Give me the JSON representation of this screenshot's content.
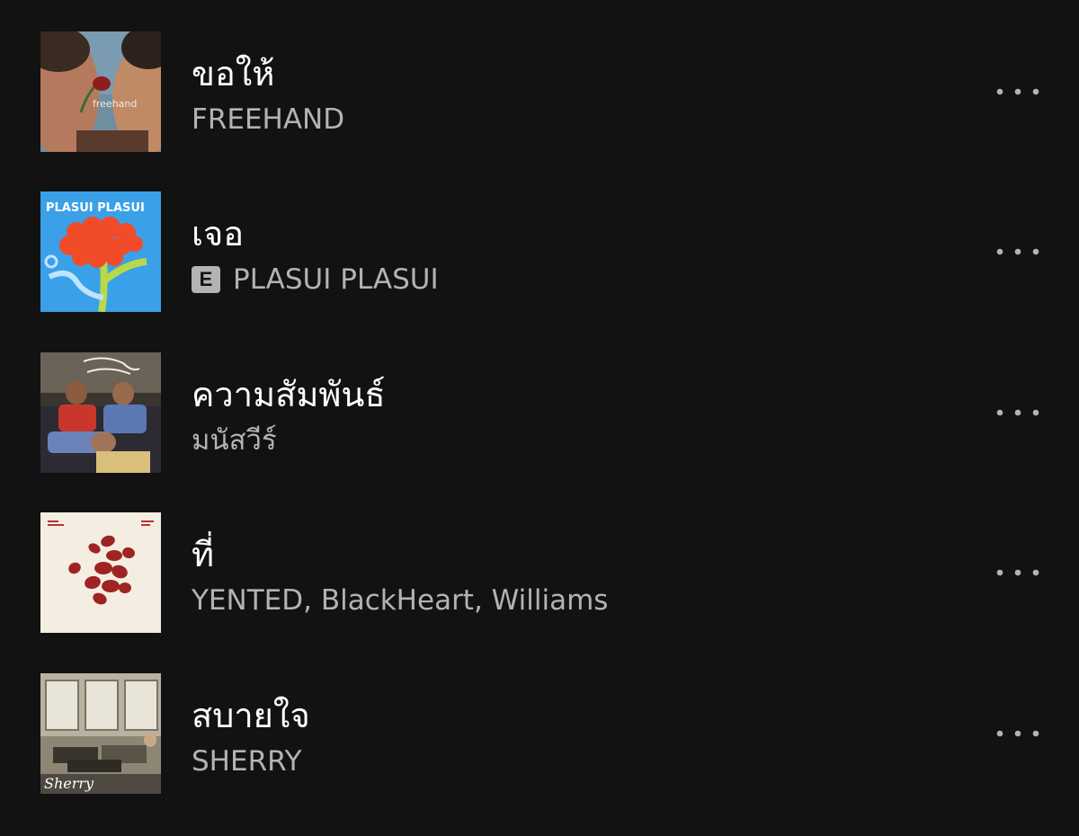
{
  "tracks": [
    {
      "title": "ขอให้",
      "artist": "FREEHAND",
      "explicit": false,
      "cover_text": "freehand",
      "more_icon": "more-horizontal-icon"
    },
    {
      "title": "เจอ",
      "artist": "PLASUI PLASUI",
      "explicit": true,
      "explicit_label": "E",
      "cover_text": "PLASUI PLASUI",
      "more_icon": "more-horizontal-icon"
    },
    {
      "title": "ความสัมพันธ์",
      "artist": "มนัสวีร์",
      "explicit": false,
      "more_icon": "more-horizontal-icon"
    },
    {
      "title": "ที่",
      "artist": "YENTED, BlackHeart, Williams",
      "explicit": false,
      "more_icon": "more-horizontal-icon"
    },
    {
      "title": "สบายใจ",
      "artist": "SHERRY",
      "explicit": false,
      "cover_text": "Sherry",
      "more_icon": "more-horizontal-icon"
    }
  ],
  "colors": {
    "background": "#121212",
    "title": "#ffffff",
    "subtitle": "#b3b3b3"
  }
}
